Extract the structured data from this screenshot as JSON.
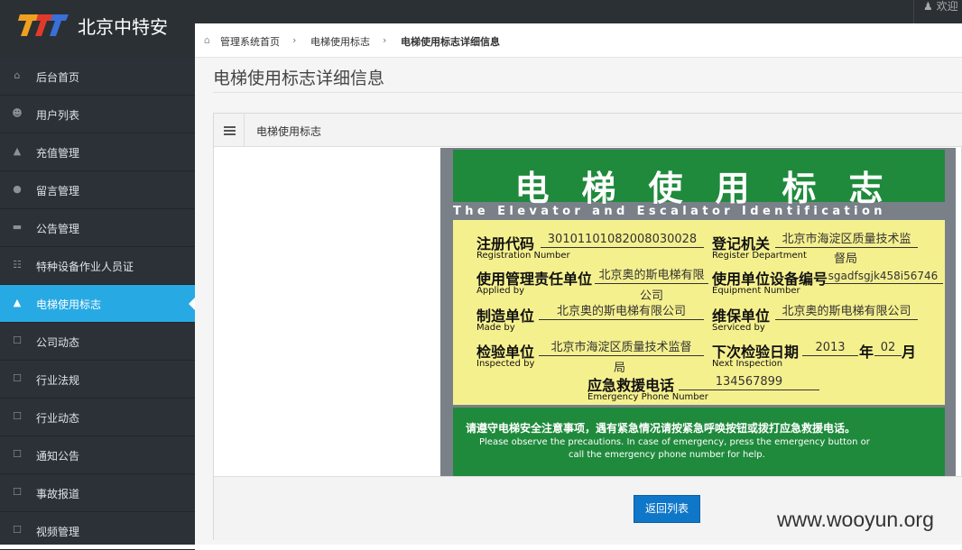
{
  "header": {
    "brand": "北京中特安",
    "welcome": "欢迎"
  },
  "sidebar": {
    "items": [
      {
        "label": "后台首页",
        "icon": "home-icon"
      },
      {
        "label": "用户列表",
        "icon": "user-icon"
      },
      {
        "label": "充值管理",
        "icon": "road-icon"
      },
      {
        "label": "留言管理",
        "icon": "comment-icon"
      },
      {
        "label": "公告管理",
        "icon": "inbox-icon"
      },
      {
        "label": "特种设备作业人员证",
        "icon": "table-icon"
      },
      {
        "label": "电梯使用标志",
        "icon": "road-icon",
        "active": true
      },
      {
        "label": "公司动态",
        "icon": "file-icon"
      },
      {
        "label": "行业法规",
        "icon": "file-icon"
      },
      {
        "label": "行业动态",
        "icon": "file-icon"
      },
      {
        "label": "通知公告",
        "icon": "file-icon"
      },
      {
        "label": "事故报道",
        "icon": "file-icon"
      },
      {
        "label": "视频管理",
        "icon": "file-icon"
      }
    ]
  },
  "breadcrumb": {
    "items": [
      "管理系统首页",
      "电梯使用标志",
      "电梯使用标志详细信息"
    ]
  },
  "page": {
    "title": "电梯使用标志详细信息"
  },
  "panel": {
    "title": "电梯使用标志",
    "back_label": "返回列表"
  },
  "sign": {
    "title": "电梯使用标志",
    "subtitle": "The Elevator and Escalator Identification",
    "reg_no_label": "注册代码",
    "reg_no_en": "Registration Number",
    "reg_no": "30101101082008030028",
    "reg_dept_label": "登记机关",
    "reg_dept_en": "Register Department",
    "reg_dept_1": "北京市海淀区质量技术监",
    "reg_dept_2": "督局",
    "user_label": "使用管理责任单位",
    "user_en": "Applied by",
    "user_1": "北京奥的斯电梯有限",
    "user_2": "公司",
    "equip_label": "使用单位设备编号",
    "equip_en": "Equipment Number",
    "equip_no": "sgadfsgjk458i56746",
    "maker_label": "制造单位",
    "maker_en": "Made by",
    "maker": "北京奥的斯电梯有限公司",
    "service_label": "维保单位",
    "service_en": "Serviced by",
    "service": "北京奥的斯电梯有限公司",
    "inspect_label": "检验单位",
    "inspect_en": "Inspected by",
    "inspect_1": "北京市海淀区质量技术监督",
    "inspect_2": "局",
    "next_label": "下次检验日期",
    "next_en": "Next Inspection",
    "next_year": "2013",
    "year_unit": "年",
    "next_month": "02",
    "month_unit": "月",
    "phone_label": "应急救援电话",
    "phone_en": "Emergency Phone Number",
    "phone": "134567899",
    "notice_cn": "请遵守电梯安全注意事项，遇有紧急情况请按紧急呼唤按钮或拨打应急救援电话。",
    "notice_en_1": "Please observe the precautions. In case of emergency, press the emergency button or",
    "notice_en_2": "call the emergency phone number for help."
  },
  "watermark": "www.wooyun.org",
  "colors": {
    "sidebar_bg": "#2c3137",
    "active": "#27a9e3",
    "sign_green": "#1f8a3c",
    "sign_yellow": "#f5f08e",
    "button": "#0f77c8"
  }
}
